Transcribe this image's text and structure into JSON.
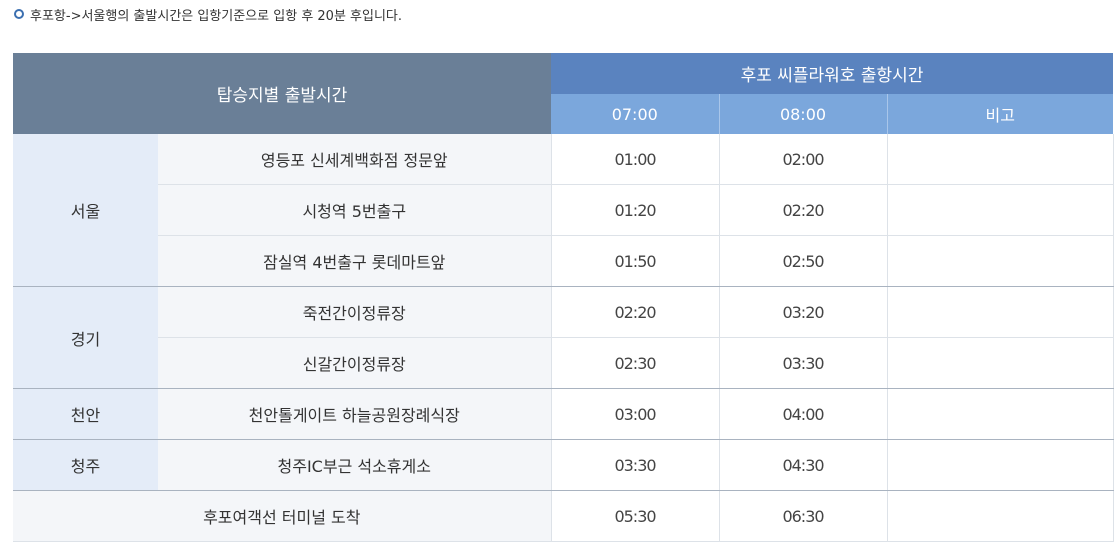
{
  "notice": "후포항->서울행의 출발시간은 입항기준으로 입항 후 20분 후입니다.",
  "table": {
    "stop_header": "탑승지별 출발시간",
    "ship_header": "후포 씨플라워호 출항시간",
    "columns": [
      "07:00",
      "08:00",
      "비고"
    ]
  },
  "rows": [
    {
      "region": "서울",
      "place": "영등포 신세계백화점 정문앞",
      "t1": "01:00",
      "t2": "02:00",
      "note": ""
    },
    {
      "region": "",
      "place": "시청역 5번출구",
      "t1": "01:20",
      "t2": "02:20",
      "note": ""
    },
    {
      "region": "",
      "place": "잠실역 4번출구 롯데마트앞",
      "t1": "01:50",
      "t2": "02:50",
      "note": ""
    },
    {
      "region": "경기",
      "place": "죽전간이정류장",
      "t1": "02:20",
      "t2": "03:20",
      "note": ""
    },
    {
      "region": "",
      "place": "신갈간이정류장",
      "t1": "02:30",
      "t2": "03:30",
      "note": ""
    },
    {
      "region": "천안",
      "place": "천안톨게이트 하늘공원장례식장",
      "t1": "03:00",
      "t2": "04:00",
      "note": ""
    },
    {
      "region": "청주",
      "place": "청주IC부근 석소휴게소",
      "t1": "03:30",
      "t2": "04:30",
      "note": ""
    },
    {
      "region": "",
      "place": "후포여객선 터미널 도착",
      "t1": "05:30",
      "t2": "06:30",
      "note": ""
    }
  ],
  "colors": {
    "header_gray": "#6a7f97",
    "header_blue": "#5a83bf",
    "subheader_blue": "#7ba7dc",
    "region_bg": "#e4ecf8"
  }
}
